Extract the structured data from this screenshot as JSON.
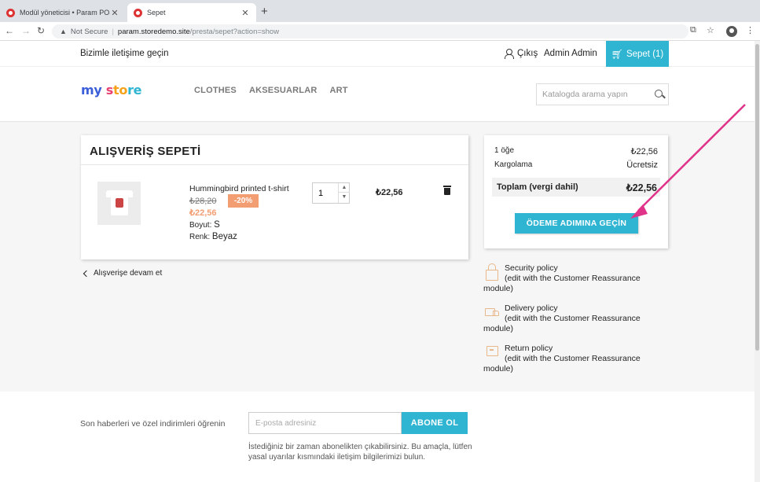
{
  "browser": {
    "tabs": [
      {
        "title": "Modül yöneticisi • Param POS"
      },
      {
        "title": "Sepet"
      }
    ],
    "security_label": "Not Secure",
    "url_host": "param.storedemo.site",
    "url_path": "/presta/sepet?action=show"
  },
  "topnav": {
    "contact": "Bizimle iletişime geçin",
    "logout": "Çıkış",
    "account": "Admin Admin",
    "cart_label": "Sepet (1)"
  },
  "header": {
    "logo": {
      "p1": "my",
      "p2": " s",
      "p3": "to",
      "p4": "re"
    },
    "menu": [
      "CLOTHES",
      "AKSESUARLAR",
      "ART"
    ],
    "search_placeholder": "Katalogda arama yapın"
  },
  "cart": {
    "title": "ALIŞVERİŞ SEPETİ",
    "product": {
      "name": "Hummingbird printed t-shirt",
      "old_price": "₺28,20",
      "discount": "-20%",
      "new_price": "₺22,56",
      "size_label": "Boyut:",
      "size_value": "S",
      "color_label": "Renk:",
      "color_value": "Beyaz",
      "quantity": "1",
      "line_total": "₺22,56"
    },
    "continue_label": "Alışverişe devam et"
  },
  "summary": {
    "items_label": "1 öğe",
    "items_value": "₺22,56",
    "shipping_label": "Kargolama",
    "shipping_value": "Ücretsiz",
    "total_label": "Toplam (vergi dahil)",
    "total_value": "₺22,56",
    "checkout_label": "ÖDEME ADIMINA GEÇİN"
  },
  "reassurance": [
    {
      "title": "Security policy",
      "line2": "(edit with the Customer Reassurance",
      "line3": "module)"
    },
    {
      "title": "Delivery policy",
      "line2": "(edit with the Customer Reassurance",
      "line3": "module)"
    },
    {
      "title": "Return policy",
      "line2": "(edit with the Customer Reassurance",
      "line3": "module)"
    }
  ],
  "newsletter": {
    "label": "Son haberleri ve özel indirimleri öğrenin",
    "placeholder": "E-posta adresiniz",
    "button": "ABONE OL",
    "note": "İstediğiniz bir zaman abonelikten çıkabilirsiniz. Bu amaçla, lütfen yasal uyarılar kısmındaki iletişim bilgilerimizi bulun."
  },
  "colors": {
    "accent": "#2fb5d2",
    "discount": "#f39d72",
    "annotation_arrow": "#e0338a"
  }
}
